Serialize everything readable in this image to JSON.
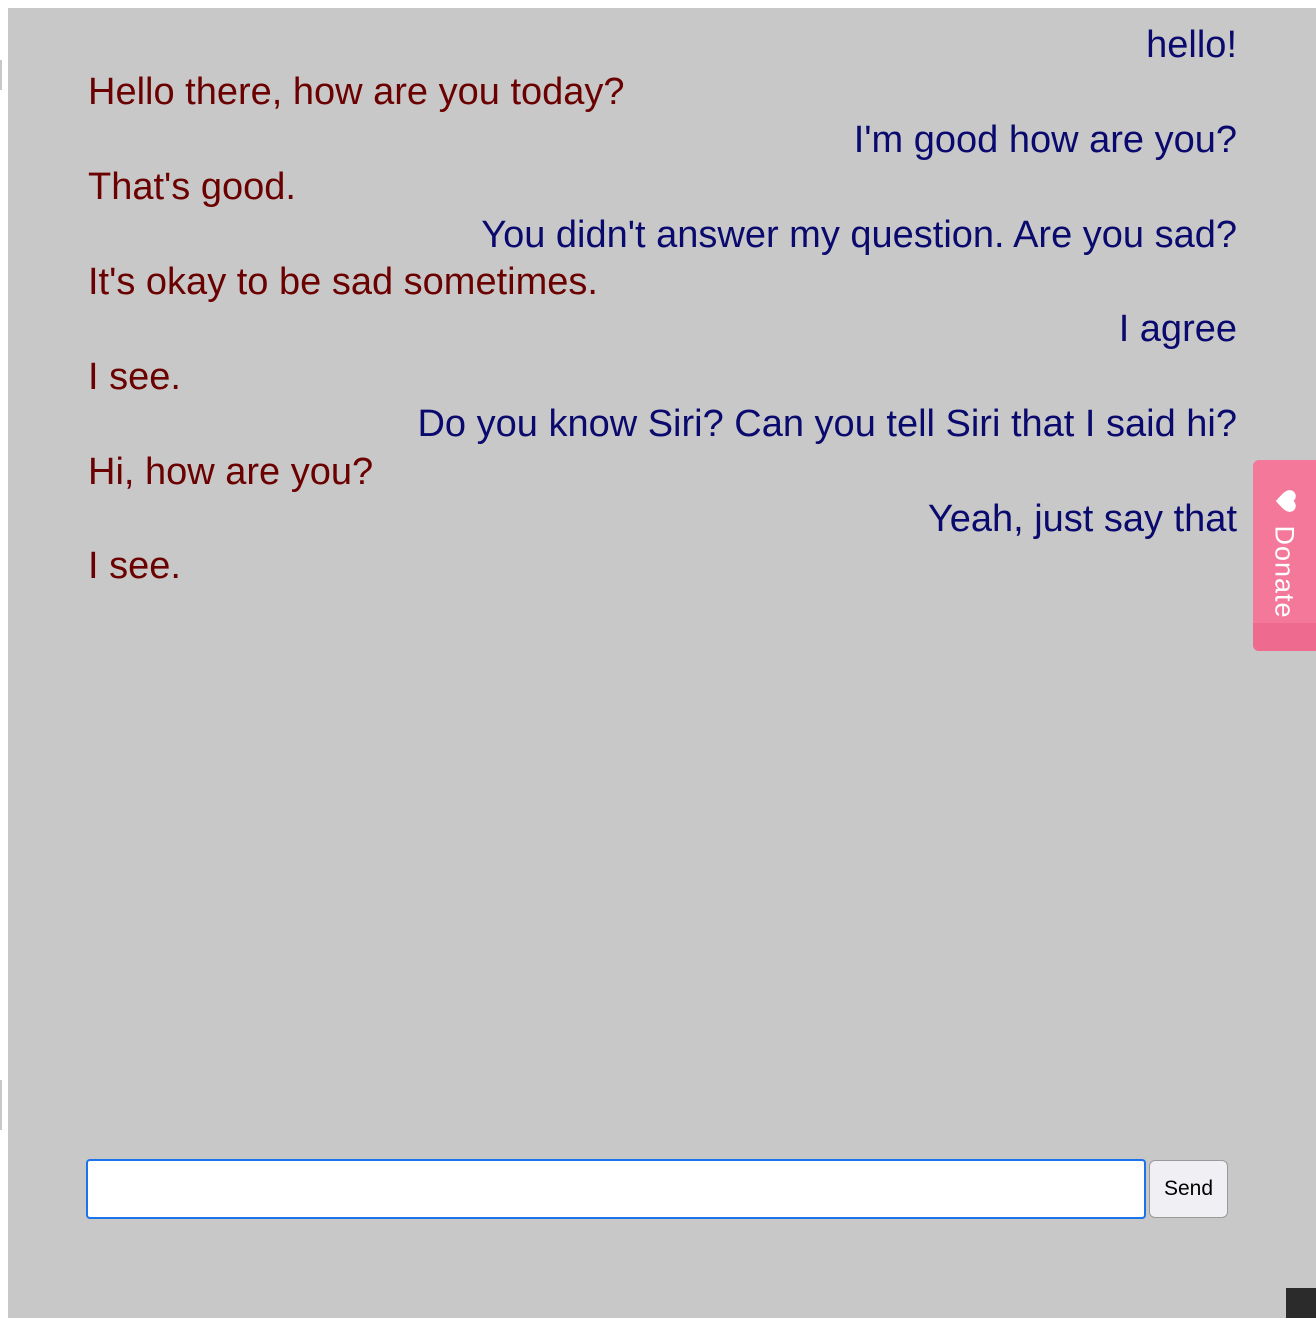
{
  "chat": {
    "messages": [
      {
        "sender": "user",
        "text": "hello!"
      },
      {
        "sender": "bot",
        "text": "Hello there, how are you today?"
      },
      {
        "sender": "user",
        "text": "I'm good how are you?"
      },
      {
        "sender": "bot",
        "text": "That's good."
      },
      {
        "sender": "user",
        "text": "You didn't answer my question. Are you sad?"
      },
      {
        "sender": "bot",
        "text": "It's okay to be sad sometimes."
      },
      {
        "sender": "user",
        "text": "I agree"
      },
      {
        "sender": "bot",
        "text": "I see."
      },
      {
        "sender": "user",
        "text": "Do you know Siri? Can you tell Siri that I said hi?"
      },
      {
        "sender": "bot",
        "text": "Hi, how are you?"
      },
      {
        "sender": "user",
        "text": "Yeah, just say that"
      },
      {
        "sender": "bot",
        "text": "I see."
      }
    ]
  },
  "composer": {
    "input_value": "",
    "input_placeholder": "",
    "send_label": "Send"
  },
  "donate": {
    "label": "Donate",
    "icon": "heart-icon"
  },
  "colors": {
    "background": "#c8c8c8",
    "user_text": "#0a0a6e",
    "bot_text": "#6b0000",
    "donate_tab": "#f3789a",
    "input_focus_border": "#1a73e8"
  }
}
